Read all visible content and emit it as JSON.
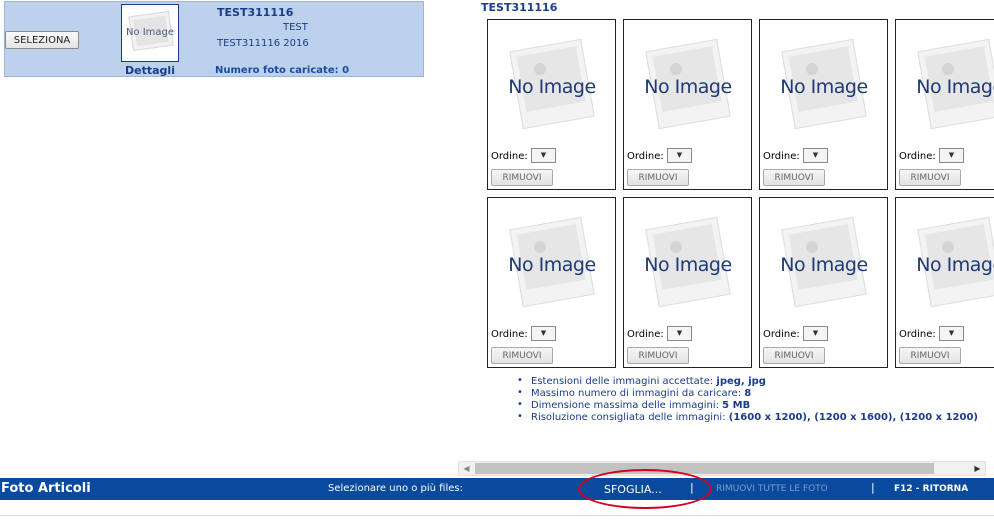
{
  "article": {
    "select_label": "SELEZIONA",
    "thumb_text": "No Image",
    "details_label": "Dettagli",
    "code": "TEST311116",
    "description": "TEST",
    "line": "TEST311116 2016",
    "photo_count": "Numero foto caricate: 0"
  },
  "gallery": {
    "title": "TEST311116",
    "slots": [
      {
        "placeholder": "No Image",
        "order_label": "Ordine:",
        "remove_label": "RIMUOVI"
      },
      {
        "placeholder": "No Image",
        "order_label": "Ordine:",
        "remove_label": "RIMUOVI"
      },
      {
        "placeholder": "No Image",
        "order_label": "Ordine:",
        "remove_label": "RIMUOVI"
      },
      {
        "placeholder": "No Image",
        "order_label": "Ordine:",
        "remove_label": "RIMUOVI"
      },
      {
        "placeholder": "No Image",
        "order_label": "Ordine:",
        "remove_label": "RIMUOVI"
      },
      {
        "placeholder": "No Image",
        "order_label": "Ordine:",
        "remove_label": "RIMUOVI"
      },
      {
        "placeholder": "No Image",
        "order_label": "Ordine:",
        "remove_label": "RIMUOVI"
      },
      {
        "placeholder": "No Image",
        "order_label": "Ordine:",
        "remove_label": "RIMUOVI"
      }
    ],
    "dropdown_icon": "chevron-down-icon"
  },
  "info": [
    {
      "label": "Estensioni delle immagini accettate: ",
      "value": "jpeg, jpg"
    },
    {
      "label": "Massimo numero di immagini da caricare: ",
      "value": "8"
    },
    {
      "label": "Dimensione massima delle immagini: ",
      "value": "5 MB"
    },
    {
      "label": "Risoluzione consigliata delle immagini: ",
      "value": "(1600 x 1200), (1200 x 1600), (1200 x 1200)"
    }
  ],
  "bottom_bar": {
    "title": "Foto Articoli",
    "hint": "Selezionare uno o più files:",
    "browse_label": "SFOGLIA...",
    "separator": "|",
    "remove_all_label": "RIMUOVI TUTTE LE FOTO",
    "return_label": "F12 - RITORNA"
  },
  "colors": {
    "bar_background": "#0a4a9e",
    "panel_background": "#bcd2ec",
    "highlight": "#d3001f",
    "text_blue": "#1a3c8a"
  }
}
